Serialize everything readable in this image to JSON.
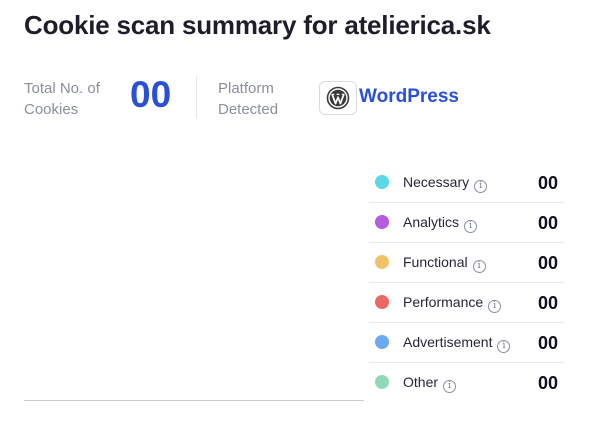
{
  "title": "Cookie scan summary for atelierica.sk",
  "summary": {
    "total_label": "Total No. of Cookies",
    "total_value": "00",
    "platform_label": "Platform Detected",
    "platform_name": "WordPress",
    "platform_icon": "wordpress-icon"
  },
  "legend": {
    "info_icon": "info-icon",
    "items": [
      {
        "label": "Necessary",
        "count": "00",
        "color": "#5ad8e5"
      },
      {
        "label": "Analytics",
        "count": "00",
        "color": "#b65be0"
      },
      {
        "label": "Functional",
        "count": "00",
        "color": "#f2c268"
      },
      {
        "label": "Performance",
        "count": "00",
        "color": "#ea6a63"
      },
      {
        "label": "Advertisement",
        "count": "00",
        "color": "#6aaaf2"
      },
      {
        "label": "Other",
        "count": "00",
        "color": "#8fd9b9"
      }
    ]
  }
}
